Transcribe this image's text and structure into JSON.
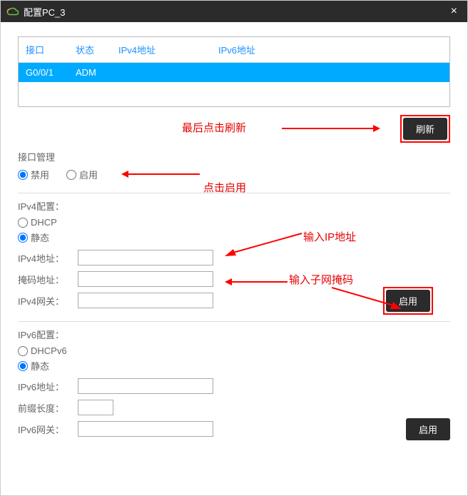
{
  "titlebar": {
    "title": "配置PC_3"
  },
  "table": {
    "headers": {
      "iface": "接口",
      "status": "状态",
      "ipv4": "IPv4地址",
      "ipv6": "IPv6地址"
    },
    "row": {
      "iface": "G0/0/1",
      "status": "ADM",
      "ipv4": "",
      "ipv6": ""
    }
  },
  "buttons": {
    "refresh": "刷新",
    "apply": "启用",
    "apply2": "启用"
  },
  "labels": {
    "ifmgmt": "接口管理",
    "disable": "禁用",
    "enable": "启用",
    "ipv4cfg": "IPv4配置：",
    "dhcp": "DHCP",
    "static": "静态",
    "ipv4addr": "IPv4地址：",
    "mask": "掩码地址：",
    "ipv4gw": "IPv4网关：",
    "ipv6cfg": "IPv6配置：",
    "dhcpv6": "DHCPv6",
    "static6": "静态",
    "ipv6addr": "IPv6地址：",
    "prefix": "前缀长度：",
    "ipv6gw": "IPv6网关："
  },
  "annotations": {
    "refresh": "最后点击刷新",
    "enable": "点击启用",
    "ip": "输入IP地址",
    "mask": "输入子网掩码"
  }
}
